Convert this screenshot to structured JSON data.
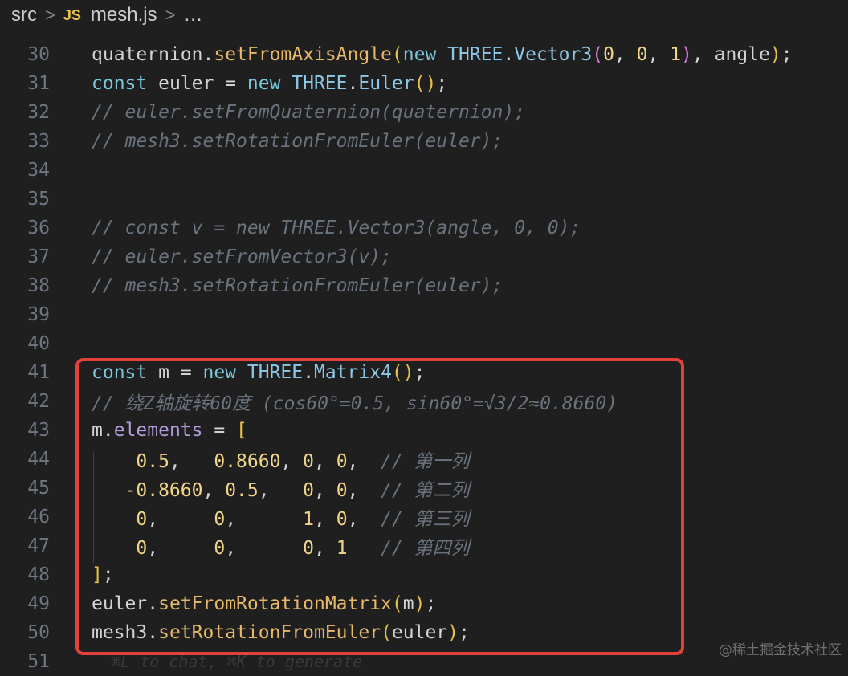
{
  "breadcrumb": {
    "folder": "src",
    "sep1": ">",
    "file_icon": "JS",
    "file": "mesh.js",
    "sep2": ">",
    "more": "…"
  },
  "lines": [
    {
      "n": "30",
      "kind": "code",
      "tokens": [
        {
          "t": "quaternion",
          "c": "var"
        },
        {
          "t": ".",
          "c": "var"
        },
        {
          "t": "setFromAxisAngle",
          "c": "fn"
        },
        {
          "t": "(",
          "c": "paren"
        },
        {
          "t": "new ",
          "c": "kw"
        },
        {
          "t": "THREE",
          "c": "cls"
        },
        {
          "t": ".",
          "c": "var"
        },
        {
          "t": "Vector3",
          "c": "cls"
        },
        {
          "t": "(",
          "c": "paren2"
        },
        {
          "t": "0",
          "c": "num"
        },
        {
          "t": ", ",
          "c": "var"
        },
        {
          "t": "0",
          "c": "num"
        },
        {
          "t": ", ",
          "c": "var"
        },
        {
          "t": "1",
          "c": "num"
        },
        {
          "t": ")",
          "c": "paren2"
        },
        {
          "t": ", angle",
          "c": "var"
        },
        {
          "t": ")",
          "c": "paren"
        },
        {
          "t": ";",
          "c": "var"
        }
      ]
    },
    {
      "n": "31",
      "kind": "code",
      "tokens": [
        {
          "t": "const ",
          "c": "kw"
        },
        {
          "t": "euler = ",
          "c": "var"
        },
        {
          "t": "new ",
          "c": "kw"
        },
        {
          "t": "THREE",
          "c": "cls"
        },
        {
          "t": ".",
          "c": "var"
        },
        {
          "t": "Euler",
          "c": "cls"
        },
        {
          "t": "()",
          "c": "paren"
        },
        {
          "t": ";",
          "c": "var"
        }
      ]
    },
    {
      "n": "32",
      "kind": "comment",
      "text": "// euler.setFromQuaternion(quaternion);"
    },
    {
      "n": "33",
      "kind": "comment",
      "text": "// mesh3.setRotationFromEuler(euler);"
    },
    {
      "n": "34",
      "kind": "comment",
      "text": ""
    },
    {
      "n": "35",
      "kind": "comment",
      "text": ""
    },
    {
      "n": "36",
      "kind": "comment",
      "text": "// const v = new THREE.Vector3(angle, 0, 0);"
    },
    {
      "n": "37",
      "kind": "comment",
      "text": "// euler.setFromVector3(v);"
    },
    {
      "n": "38",
      "kind": "comment",
      "text": "// mesh3.setRotationFromEuler(euler);"
    },
    {
      "n": "39",
      "kind": "comment",
      "text": ""
    },
    {
      "n": "40",
      "kind": "comment",
      "text": ""
    },
    {
      "n": "41",
      "kind": "code",
      "tokens": [
        {
          "t": "const ",
          "c": "kw"
        },
        {
          "t": "m = ",
          "c": "var"
        },
        {
          "t": "new ",
          "c": "kw"
        },
        {
          "t": "THREE",
          "c": "cls"
        },
        {
          "t": ".",
          "c": "var"
        },
        {
          "t": "Matrix4",
          "c": "cls"
        },
        {
          "t": "()",
          "c": "paren"
        },
        {
          "t": ";",
          "c": "var"
        }
      ]
    },
    {
      "n": "42",
      "kind": "comment",
      "text": "// 绕Z轴旋转60度 (cos60°=0.5, sin60°=√3/2≈0.8660)"
    },
    {
      "n": "43",
      "kind": "code",
      "tokens": [
        {
          "t": "m",
          "c": "var"
        },
        {
          "t": ".",
          "c": "var"
        },
        {
          "t": "elements",
          "c": "prop2"
        },
        {
          "t": " = ",
          "c": "var"
        },
        {
          "t": "[",
          "c": "paren"
        }
      ]
    },
    {
      "n": "44",
      "kind": "code",
      "tokens": [
        {
          "t": "    ",
          "c": "var"
        },
        {
          "t": "0.5",
          "c": "num"
        },
        {
          "t": ",   ",
          "c": "var"
        },
        {
          "t": "0.8660",
          "c": "num"
        },
        {
          "t": ", ",
          "c": "var"
        },
        {
          "t": "0",
          "c": "num"
        },
        {
          "t": ", ",
          "c": "var"
        },
        {
          "t": "0",
          "c": "num"
        },
        {
          "t": ",  ",
          "c": "var"
        },
        {
          "t": "// 第一列",
          "c": "comment"
        }
      ]
    },
    {
      "n": "45",
      "kind": "code",
      "tokens": [
        {
          "t": "   ",
          "c": "var"
        },
        {
          "t": "-0.8660",
          "c": "num"
        },
        {
          "t": ", ",
          "c": "var"
        },
        {
          "t": "0.5",
          "c": "num"
        },
        {
          "t": ",   ",
          "c": "var"
        },
        {
          "t": "0",
          "c": "num"
        },
        {
          "t": ", ",
          "c": "var"
        },
        {
          "t": "0",
          "c": "num"
        },
        {
          "t": ",  ",
          "c": "var"
        },
        {
          "t": "// 第二列",
          "c": "comment"
        }
      ]
    },
    {
      "n": "46",
      "kind": "code",
      "tokens": [
        {
          "t": "    ",
          "c": "var"
        },
        {
          "t": "0",
          "c": "num"
        },
        {
          "t": ",     ",
          "c": "var"
        },
        {
          "t": "0",
          "c": "num"
        },
        {
          "t": ",      ",
          "c": "var"
        },
        {
          "t": "1",
          "c": "num"
        },
        {
          "t": ", ",
          "c": "var"
        },
        {
          "t": "0",
          "c": "num"
        },
        {
          "t": ",  ",
          "c": "var"
        },
        {
          "t": "// 第三列",
          "c": "comment"
        }
      ]
    },
    {
      "n": "47",
      "kind": "code",
      "tokens": [
        {
          "t": "    ",
          "c": "var"
        },
        {
          "t": "0",
          "c": "num"
        },
        {
          "t": ",     ",
          "c": "var"
        },
        {
          "t": "0",
          "c": "num"
        },
        {
          "t": ",      ",
          "c": "var"
        },
        {
          "t": "0",
          "c": "num"
        },
        {
          "t": ", ",
          "c": "var"
        },
        {
          "t": "1",
          "c": "num"
        },
        {
          "t": "   ",
          "c": "var"
        },
        {
          "t": "// 第四列",
          "c": "comment"
        }
      ]
    },
    {
      "n": "48",
      "kind": "code",
      "tokens": [
        {
          "t": "]",
          "c": "paren"
        },
        {
          "t": ";",
          "c": "var"
        }
      ]
    },
    {
      "n": "49",
      "kind": "code",
      "tokens": [
        {
          "t": "euler",
          "c": "var"
        },
        {
          "t": ".",
          "c": "var"
        },
        {
          "t": "setFromRotationMatrix",
          "c": "fn"
        },
        {
          "t": "(",
          "c": "paren"
        },
        {
          "t": "m",
          "c": "var"
        },
        {
          "t": ")",
          "c": "paren"
        },
        {
          "t": ";",
          "c": "var"
        }
      ]
    },
    {
      "n": "50",
      "kind": "code",
      "tokens": [
        {
          "t": "mesh3",
          "c": "var"
        },
        {
          "t": ".",
          "c": "var"
        },
        {
          "t": "setRotationFromEuler",
          "c": "fn"
        },
        {
          "t": "(",
          "c": "paren"
        },
        {
          "t": "euler",
          "c": "var"
        },
        {
          "t": ")",
          "c": "paren"
        },
        {
          "t": ";",
          "c": "var"
        }
      ]
    },
    {
      "n": "51",
      "kind": "faint",
      "text": "  ⌘L to chat, ⌘K to generate"
    }
  ],
  "watermark": "@稀土掘金技术社区",
  "colors": {
    "highlight_border": "#e5413b",
    "keyword": "#7ac7d9",
    "function": "#e8b96a",
    "number": "#f0d58a",
    "comment": "#6a737d"
  }
}
